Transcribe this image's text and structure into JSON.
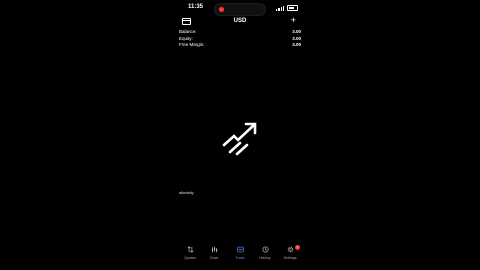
{
  "status_bar": {
    "time": "11:35"
  },
  "header": {
    "title": "USD"
  },
  "account": {
    "rows": [
      {
        "label": "Balance:",
        "value": "3.00"
      },
      {
        "label": "Equity:",
        "value": "3.00"
      },
      {
        "label": "Free Margin:",
        "value": "3.00"
      }
    ]
  },
  "watermark": "albetaliy",
  "tabs": [
    {
      "label": "Quotes",
      "icon": "quotes-icon"
    },
    {
      "label": "Chart",
      "icon": "chart-icon"
    },
    {
      "label": "Trade",
      "icon": "trade-icon",
      "active": true
    },
    {
      "label": "History",
      "icon": "history-icon"
    },
    {
      "label": "Settings",
      "icon": "settings-icon",
      "badge": "1"
    }
  ],
  "colors": {
    "accent": "#5b8def",
    "background": "#000000",
    "record": "#ff3b30"
  }
}
